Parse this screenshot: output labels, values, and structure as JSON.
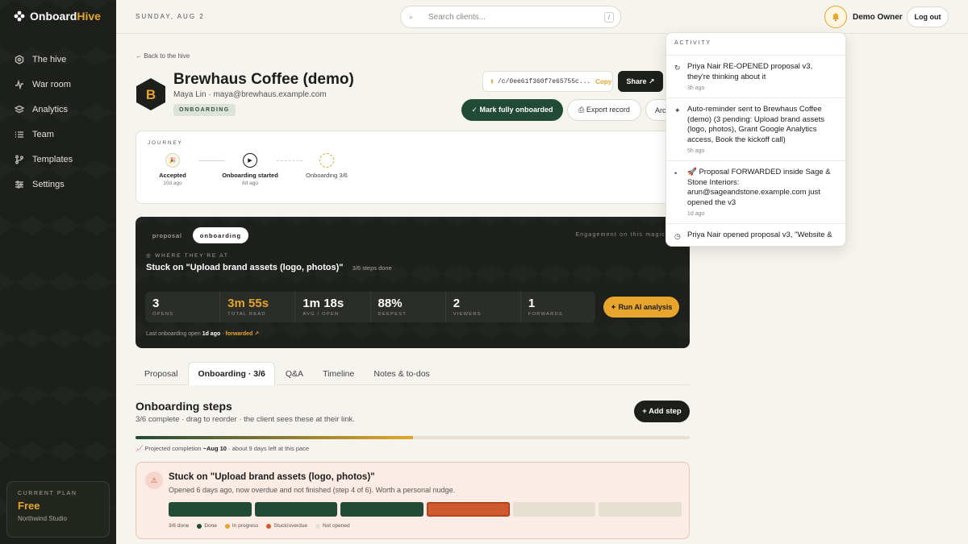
{
  "app": {
    "name_a": "Onboard",
    "name_b": "Hive"
  },
  "sidebar": {
    "items": [
      {
        "label": "The hive",
        "icon": "hive-icon"
      },
      {
        "label": "War room",
        "icon": "activity-icon"
      },
      {
        "label": "Analytics",
        "icon": "layers-icon"
      },
      {
        "label": "Team",
        "icon": "list-icon"
      },
      {
        "label": "Templates",
        "icon": "branch-icon"
      },
      {
        "label": "Settings",
        "icon": "sliders-icon"
      }
    ],
    "plan": {
      "label": "CURRENT PLAN",
      "name": "Free",
      "org": "Northwind Studio"
    }
  },
  "topbar": {
    "date": "SUNDAY, AUG 2",
    "search_placeholder": "Search clients...",
    "search_shortcut": "/",
    "user": "Demo Owner",
    "logout": "Log out"
  },
  "client": {
    "back": "← Back to the hive",
    "initial": "B",
    "name": "Brewhaus Coffee (demo)",
    "subtitle": "Maya Lin · maya@brewhaus.example.com",
    "status": "ONBOARDING",
    "link": "/c/0ee61f360f7e65755c...",
    "copy": "Copy",
    "share": "Share ↗",
    "mark_onboarded": "✓ Mark fully onboarded",
    "export": "⎙ Export record",
    "archive": "Arc"
  },
  "journey": {
    "label": "JOURNEY",
    "steps": [
      {
        "title": "Accepted",
        "sub": "10d ago"
      },
      {
        "title": "Onboarding started",
        "sub": "8d ago"
      },
      {
        "title": "Onboarding 3/6",
        "sub": ""
      }
    ]
  },
  "engagement": {
    "tabs": [
      "proposal",
      "onboarding"
    ],
    "active_tab": "onboarding",
    "header_right": "Engagement on this magic",
    "where_label": "◎ WHERE THEY'RE AT",
    "stuck": "Stuck on \"Upload brand assets (logo, photos)\"",
    "steps_done": "3/6 steps done",
    "stats": [
      {
        "value": "3",
        "label": "OPENS"
      },
      {
        "value": "3m 55s",
        "label": "TOTAL READ",
        "highlight": true
      },
      {
        "value": "1m 18s",
        "label": "AVG / OPEN"
      },
      {
        "value": "88%",
        "label": "DEEPEST"
      },
      {
        "value": "2",
        "label": "VIEWERS"
      },
      {
        "value": "1",
        "label": "FORWARDS"
      }
    ],
    "ai_button": "✦ Run AI analysis",
    "last_open_prefix": "Last onboarding open",
    "last_open_value": "1d ago",
    "last_open_sep": " · ",
    "forwarded": "forwarded ↗"
  },
  "tabs": [
    "Proposal",
    "Onboarding · 3/6",
    "Q&A",
    "Timeline",
    "Notes & to-dos"
  ],
  "active_tab": "Onboarding · 3/6",
  "onboarding": {
    "title": "Onboarding steps",
    "subtitle": "3/6 complete · drag to reorder · the client sees these at their link.",
    "add_step": "+ Add step",
    "progress": 0.5,
    "projected_prefix": "📈 Projected completion",
    "projected_date": "~Aug 10",
    "projected_suffix": " · about 9 days left at this pace"
  },
  "alert": {
    "title": "Stuck on \"Upload brand assets (logo, photos)\"",
    "subtitle": "Opened 6 days ago, now overdue and not finished (step 4 of 6). Worth a personal nudge.",
    "segments": [
      "done",
      "done",
      "done",
      "stuck",
      "not_opened",
      "not_opened"
    ],
    "done_label": "3/6 done",
    "legend": [
      {
        "label": "Done",
        "color": "#214a37"
      },
      {
        "label": "In progress",
        "color": "#e7a52c"
      },
      {
        "label": "Stuck/overdue",
        "color": "#d05a2e"
      },
      {
        "label": "Not opened",
        "color": "#e5e0cf"
      }
    ]
  },
  "colors": {
    "done": "#214a37",
    "stuck": "#d05a2e",
    "not_opened": "#e5e0cf",
    "accent": "#e7a52c"
  },
  "activity": {
    "label": "ACTIVITY",
    "items": [
      {
        "icon": "↻",
        "text": "Priya Nair RE-OPENED proposal v3, they're thinking about it",
        "time": "3h ago"
      },
      {
        "icon": "✦",
        "text": "Auto-reminder sent to Brewhaus Coffee (demo) (3 pending: Upload brand assets (logo, photos), Grant Google Analytics access, Book the kickoff call)",
        "time": "5h ago"
      },
      {
        "icon": "•",
        "text": "🚀 Proposal FORWARDED inside Sage & Stone Interiors: arun@sageandstone.example.com just opened the v3",
        "time": "1d ago"
      },
      {
        "icon": "◷",
        "text": "Priya Nair opened proposal v3, \"Website &",
        "time": ""
      }
    ]
  }
}
